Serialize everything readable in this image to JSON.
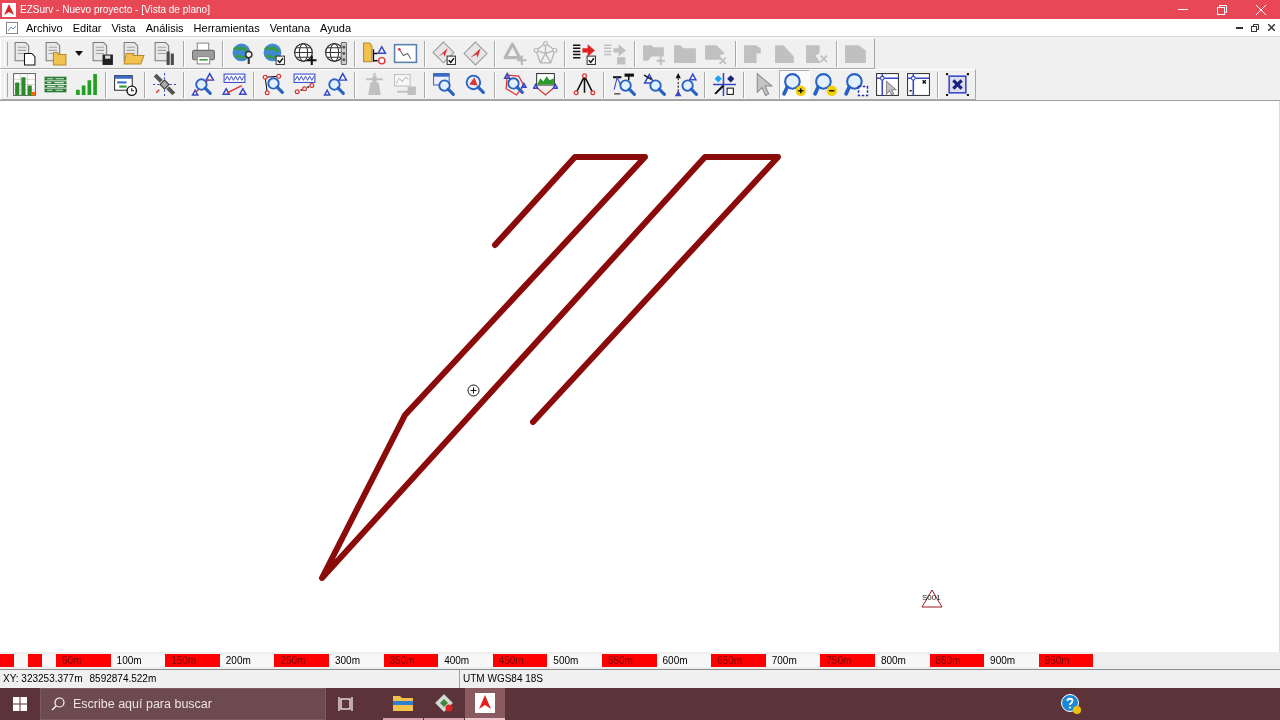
{
  "window": {
    "title": "EZSurv - Nuevo proyecto - [Vista de plano]"
  },
  "menu": [
    "Archivo",
    "Editar",
    "Vista",
    "Análisis",
    "Herramientas",
    "Ventana",
    "Ayuda"
  ],
  "toolbars": [
    {
      "groups": [
        [
          {
            "kind": "tool",
            "disabled": false,
            "pressed": false
          },
          {
            "kind": "tool",
            "disabled": false,
            "pressed": false
          },
          {
            "kind": "dropdown",
            "disabled": false,
            "pressed": false
          },
          {
            "kind": "tool",
            "disabled": false,
            "pressed": false
          },
          {
            "kind": "tool",
            "disabled": false,
            "pressed": false
          },
          {
            "kind": "tool",
            "disabled": false,
            "pressed": false
          }
        ],
        [
          {
            "kind": "tool",
            "disabled": false,
            "pressed": false
          }
        ],
        [
          {
            "kind": "tool",
            "disabled": false,
            "pressed": false
          },
          {
            "kind": "tool",
            "disabled": false,
            "pressed": false
          },
          {
            "kind": "tool",
            "disabled": false,
            "pressed": false
          },
          {
            "kind": "tool",
            "disabled": false,
            "pressed": false
          }
        ],
        [
          {
            "kind": "tool",
            "disabled": false,
            "pressed": false
          },
          {
            "kind": "tool",
            "disabled": false,
            "pressed": false
          }
        ],
        [
          {
            "kind": "tool",
            "disabled": false,
            "pressed": false
          },
          {
            "kind": "tool",
            "disabled": false,
            "pressed": false
          }
        ],
        [
          {
            "kind": "tool",
            "disabled": true,
            "pressed": false
          },
          {
            "kind": "tool",
            "disabled": true,
            "pressed": false
          }
        ],
        [
          {
            "kind": "tool",
            "disabled": false,
            "pressed": false
          },
          {
            "kind": "tool",
            "disabled": true,
            "pressed": false
          }
        ],
        [
          {
            "kind": "tool",
            "disabled": true,
            "pressed": false
          },
          {
            "kind": "tool",
            "disabled": true,
            "pressed": false
          },
          {
            "kind": "tool",
            "disabled": true,
            "pressed": false
          }
        ],
        [
          {
            "kind": "tool",
            "disabled": true,
            "pressed": false
          },
          {
            "kind": "tool",
            "disabled": true,
            "pressed": false
          },
          {
            "kind": "tool",
            "disabled": true,
            "pressed": false
          }
        ],
        [
          {
            "kind": "tool",
            "disabled": true,
            "pressed": false
          }
        ]
      ]
    },
    {
      "groups": [
        [
          {
            "kind": "tool",
            "disabled": false,
            "pressed": false
          },
          {
            "kind": "tool",
            "disabled": false,
            "pressed": false
          },
          {
            "kind": "tool",
            "disabled": false,
            "pressed": false
          }
        ],
        [
          {
            "kind": "tool",
            "disabled": false,
            "pressed": false
          }
        ],
        [
          {
            "kind": "tool",
            "disabled": false,
            "pressed": false
          }
        ],
        [
          {
            "kind": "tool",
            "disabled": false,
            "pressed": false
          },
          {
            "kind": "tool",
            "disabled": false,
            "pressed": false
          }
        ],
        [
          {
            "kind": "tool",
            "disabled": false,
            "pressed": false
          },
          {
            "kind": "tool",
            "disabled": false,
            "pressed": false
          },
          {
            "kind": "tool",
            "disabled": false,
            "pressed": false
          }
        ],
        [
          {
            "kind": "tool",
            "disabled": true,
            "pressed": false
          },
          {
            "kind": "tool",
            "disabled": true,
            "pressed": false
          }
        ],
        [
          {
            "kind": "tool",
            "disabled": false,
            "pressed": false
          },
          {
            "kind": "tool",
            "disabled": false,
            "pressed": false
          }
        ],
        [
          {
            "kind": "tool",
            "disabled": false,
            "pressed": false
          },
          {
            "kind": "tool",
            "disabled": false,
            "pressed": false
          }
        ],
        [
          {
            "kind": "tool",
            "disabled": false,
            "pressed": false
          }
        ],
        [
          {
            "kind": "tool",
            "disabled": false,
            "pressed": false
          },
          {
            "kind": "tool",
            "disabled": false,
            "pressed": false
          },
          {
            "kind": "tool",
            "disabled": false,
            "pressed": false
          }
        ],
        [
          {
            "kind": "tool",
            "disabled": false,
            "pressed": false
          }
        ],
        [
          {
            "kind": "tool",
            "disabled": false,
            "pressed": false
          },
          {
            "kind": "tool",
            "disabled": false,
            "pressed": true
          },
          {
            "kind": "tool",
            "disabled": false,
            "pressed": false
          },
          {
            "kind": "tool",
            "disabled": false,
            "pressed": false
          },
          {
            "kind": "tool",
            "disabled": false,
            "pressed": false
          },
          {
            "kind": "tool",
            "disabled": false,
            "pressed": false
          }
        ],
        [
          {
            "kind": "tool",
            "disabled": false,
            "pressed": false
          }
        ]
      ]
    }
  ],
  "map": {
    "points": [
      {
        "label": "S001"
      }
    ]
  },
  "scale_bar": {
    "segments": [
      {
        "kind": "minor",
        "filled": true
      },
      {
        "kind": "minor",
        "filled": false
      },
      {
        "kind": "minor",
        "filled": true
      },
      {
        "kind": "minor",
        "filled": false
      },
      {
        "kind": "major",
        "filled": true,
        "label": "50m"
      },
      {
        "kind": "major",
        "filled": false,
        "label": "100m"
      },
      {
        "kind": "major",
        "filled": true,
        "label": "150m"
      },
      {
        "kind": "major",
        "filled": false,
        "label": "200m"
      },
      {
        "kind": "major",
        "filled": true,
        "label": "250m"
      },
      {
        "kind": "major",
        "filled": false,
        "label": "300m"
      },
      {
        "kind": "major",
        "filled": true,
        "label": "350m"
      },
      {
        "kind": "major",
        "filled": false,
        "label": "400m"
      },
      {
        "kind": "major",
        "filled": true,
        "label": "450m"
      },
      {
        "kind": "major",
        "filled": false,
        "label": "500m"
      },
      {
        "kind": "major",
        "filled": true,
        "label": "550m"
      },
      {
        "kind": "major",
        "filled": false,
        "label": "600m"
      },
      {
        "kind": "major",
        "filled": true,
        "label": "650m"
      },
      {
        "kind": "major",
        "filled": false,
        "label": "700m"
      },
      {
        "kind": "major",
        "filled": true,
        "label": "750m"
      },
      {
        "kind": "major",
        "filled": false,
        "label": "800m"
      },
      {
        "kind": "major",
        "filled": true,
        "label": "850m"
      },
      {
        "kind": "major",
        "filled": false,
        "label": "900m"
      },
      {
        "kind": "major",
        "filled": true,
        "label": "950m"
      }
    ]
  },
  "status_bar": {
    "coordinates": [
      "XY: 323253.377m",
      "8592874.522m"
    ],
    "projection": "UTM WGS84 18S"
  },
  "taskbar": {
    "search": {
      "placeholder": "Escribe aquí para buscar"
    },
    "apps": [
      {
        "selected": false
      },
      {
        "selected": false
      },
      {
        "selected": true
      }
    ]
  }
}
